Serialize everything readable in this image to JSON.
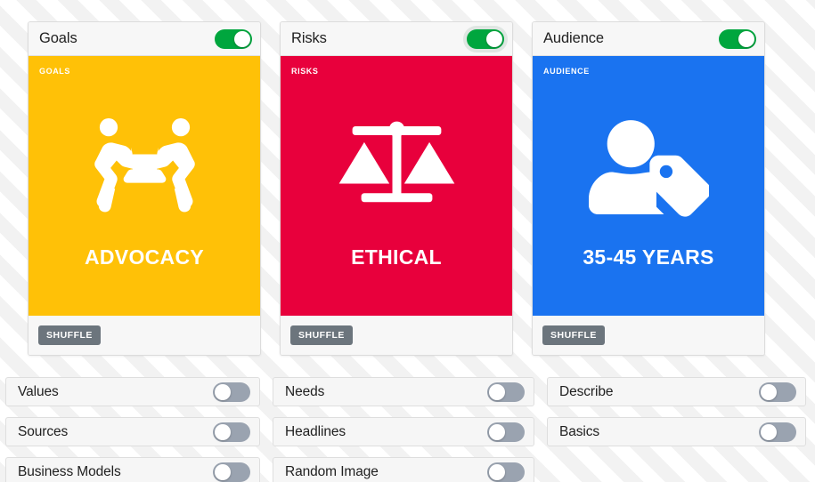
{
  "cards": [
    {
      "title": "Goals",
      "kicker": "GOALS",
      "value": "ADVOCACY",
      "shuffle_label": "SHUFFLE",
      "color": "#FFC107",
      "toggle_on": true,
      "toggle_focused": false,
      "icon": "people-carry-icon"
    },
    {
      "title": "Risks",
      "kicker": "RISKS",
      "value": "ETHICAL",
      "shuffle_label": "SHUFFLE",
      "color": "#E8003C",
      "toggle_on": true,
      "toggle_focused": true,
      "icon": "balance-scale-icon"
    },
    {
      "title": "Audience",
      "kicker": "AUDIENCE",
      "value": "35-45 YEARS",
      "shuffle_label": "SHUFFLE",
      "color": "#1A73F0",
      "toggle_on": true,
      "toggle_focused": false,
      "icon": "user-tag-icon"
    }
  ],
  "switch_columns": [
    {
      "rows": [
        {
          "label": "Values",
          "toggle_on": false
        },
        {
          "label": "Sources",
          "toggle_on": false
        },
        {
          "label": "Business Models",
          "toggle_on": false
        }
      ]
    },
    {
      "rows": [
        {
          "label": "Needs",
          "toggle_on": false
        },
        {
          "label": "Headlines",
          "toggle_on": false
        },
        {
          "label": "Random Image",
          "toggle_on": false
        }
      ]
    },
    {
      "rows": [
        {
          "label": "Describe",
          "toggle_on": false
        },
        {
          "label": "Basics",
          "toggle_on": false
        }
      ]
    }
  ],
  "colors": {
    "toggle_on": "#00a63e",
    "toggle_off": "#9aa3b0",
    "shuffle_button": "#6c757d",
    "background_stripe": "#f2f2f2"
  }
}
